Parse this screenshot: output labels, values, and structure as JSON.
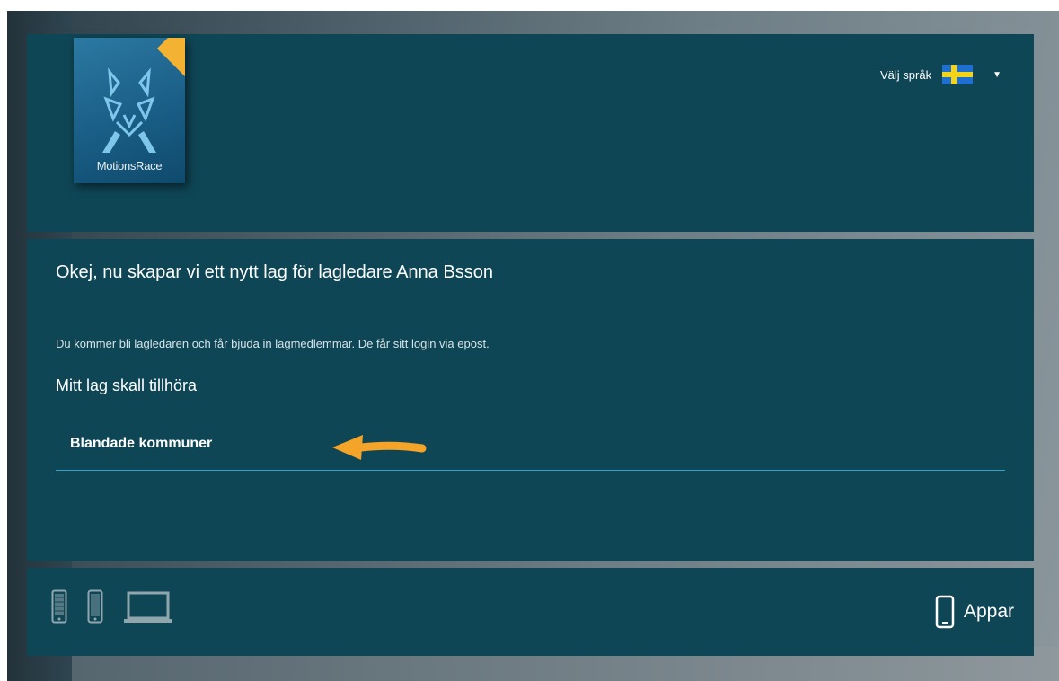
{
  "brand": {
    "logo_text": "MotionsRace"
  },
  "language": {
    "label": "Välj språk",
    "flag": "sweden-flag-icon",
    "caret": "▼"
  },
  "content": {
    "title": "Okej, nu skapar vi ett nytt lag för lagledare Anna Bsson",
    "subtitle": "Du kommer bli lagledaren och får bjuda in lagmedlemmar. De får sitt login via epost.",
    "field_label": "Mitt lag skall tillhöra",
    "selected_value": "Blandade kommuner",
    "annotation": "arrow-left-icon"
  },
  "footer": {
    "device_icons": [
      "tablet-icon",
      "phone-icon",
      "laptop-icon"
    ],
    "apps_label": "Appar",
    "apps_icon": "phone-outline-icon"
  },
  "colors": {
    "panel": "#0f4656",
    "accent_line": "#3aa0c4",
    "arrow": "#f4a428",
    "ribbon": "#f4b233"
  }
}
